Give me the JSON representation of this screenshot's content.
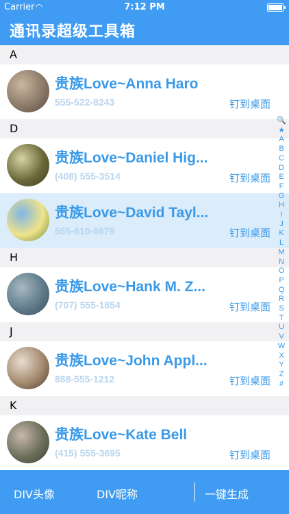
{
  "status": {
    "carrier": "Carrier",
    "time": "7:12 PM"
  },
  "nav": {
    "title": "通讯录超级工具箱"
  },
  "sections": [
    {
      "letter": "A",
      "contacts": [
        {
          "name": "贵族Love~Anna Haro",
          "phone": "555-522-8243",
          "pin": "钉到桌面",
          "avatar_colors": [
            "#8c7a6a",
            "#c9b89e",
            "#5a4a3c"
          ],
          "selected": false
        }
      ]
    },
    {
      "letter": "D",
      "contacts": [
        {
          "name": "贵族Love~Daniel Hig...",
          "phone": "(408) 555-3514",
          "pin": "钉到桌面",
          "avatar_colors": [
            "#6c6a3a",
            "#d7d2a4",
            "#3a3920"
          ],
          "selected": false
        },
        {
          "name": "贵族Love~David Tayl...",
          "phone": "555-610-6679",
          "pin": "钉到桌面",
          "avatar_colors": [
            "#f0e38a",
            "#7fb6e4",
            "#6a8b3a"
          ],
          "selected": true
        }
      ]
    },
    {
      "letter": "H",
      "contacts": [
        {
          "name": "贵族Love~Hank M. Z...",
          "phone": "(707) 555-1854",
          "pin": "钉到桌面",
          "avatar_colors": [
            "#5f7b8a",
            "#a7b9c2",
            "#3e4c56"
          ],
          "selected": false
        }
      ]
    },
    {
      "letter": "J",
      "contacts": [
        {
          "name": "贵族Love~John Appl...",
          "phone": "888-555-1212",
          "pin": "钉到桌面",
          "avatar_colors": [
            "#a48a6e",
            "#e7ddd0",
            "#4c3d30"
          ],
          "selected": false
        }
      ]
    },
    {
      "letter": "K",
      "contacts": [
        {
          "name": "贵族Love~Kate Bell",
          "phone": "(415) 555-3695",
          "pin": "钉到桌面",
          "avatar_colors": [
            "#6b6f5a",
            "#c8b7ae",
            "#3d3f34"
          ],
          "selected": false
        }
      ]
    }
  ],
  "index_letters": [
    "🔍",
    "★",
    "A",
    "B",
    "C",
    "D",
    "E",
    "F",
    "G",
    "H",
    "I",
    "J",
    "K",
    "L",
    "M",
    "N",
    "O",
    "P",
    "Q",
    "R",
    "S",
    "T",
    "U",
    "V",
    "W",
    "X",
    "Y",
    "Z",
    "#"
  ],
  "bottom": {
    "avatar_btn": "DIV头像",
    "nickname_btn": "DIV昵称",
    "generate_btn": "一键生成"
  },
  "colors": {
    "accent": "#3f9cf2",
    "name": "#3a9ae8",
    "phone": "#b9d5ee",
    "selected_row": "#dbecfb",
    "section_bg": "#f1f1f3"
  }
}
